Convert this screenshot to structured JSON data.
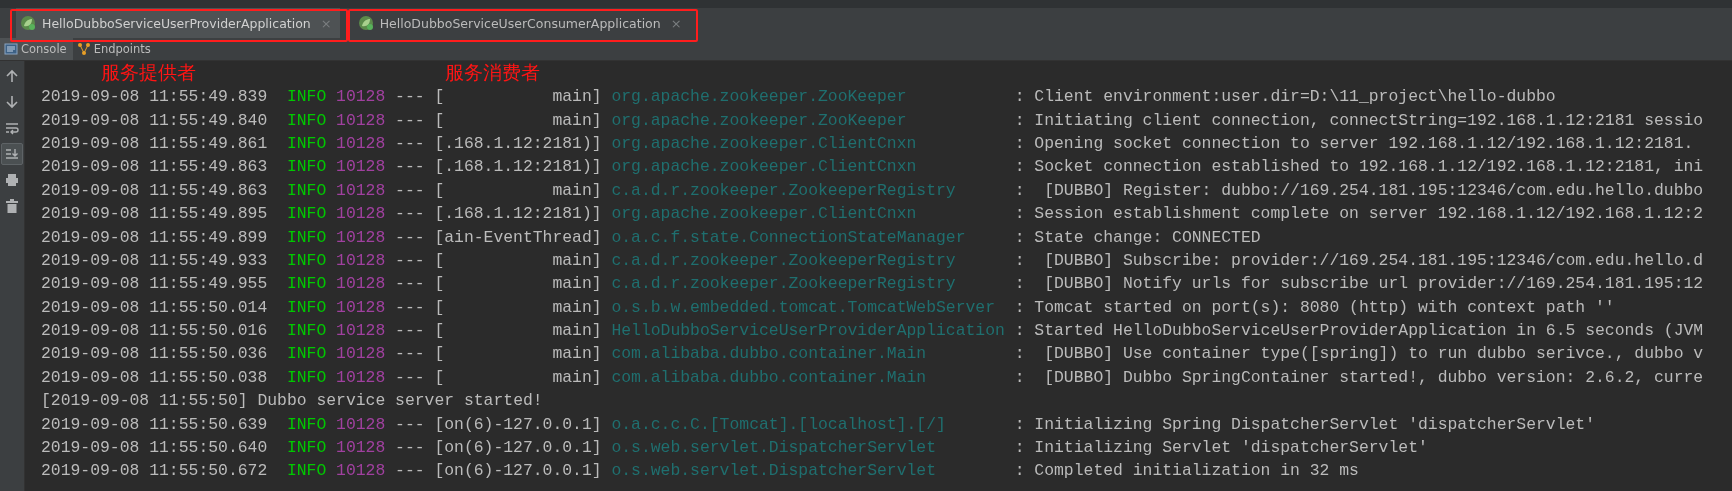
{
  "run_tabs": [
    {
      "label": "HelloDubboServiceUserProviderApplication",
      "close": "×",
      "selected": true,
      "highlighted": true
    },
    {
      "label": "HelloDubboServiceUserConsumerApplication",
      "close": "×",
      "selected": false,
      "highlighted": true
    }
  ],
  "console_tabs": [
    {
      "label": "Console",
      "kind": "console",
      "selected": true
    },
    {
      "label": "Endpoints",
      "kind": "endpoints",
      "selected": false
    }
  ],
  "gutter_tools": [
    {
      "kind": "up",
      "selected": false
    },
    {
      "kind": "down",
      "selected": false
    },
    {
      "kind": "wrap",
      "selected": false
    },
    {
      "kind": "scroll-end",
      "selected": true
    },
    {
      "kind": "print",
      "selected": false
    },
    {
      "kind": "trash",
      "selected": false
    }
  ],
  "log_lines": [
    {
      "kind": "log",
      "time": "2019-09-08 11:55:49.839",
      "level": "INFO",
      "pid": "10128",
      "sep": "---",
      "thread": "[           main]",
      "logger": "org.apache.zookeeper.ZooKeeper",
      "message": ": Client environment:user.dir=D:\\11_project\\hello-dubbo"
    },
    {
      "kind": "log",
      "time": "2019-09-08 11:55:49.840",
      "level": "INFO",
      "pid": "10128",
      "sep": "---",
      "thread": "[           main]",
      "logger": "org.apache.zookeeper.ZooKeeper",
      "message": ": Initiating client connection, connectString=192.168.1.12:2181 sessio"
    },
    {
      "kind": "log",
      "time": "2019-09-08 11:55:49.861",
      "level": "INFO",
      "pid": "10128",
      "sep": "---",
      "thread": "[.168.1.12:2181)]",
      "logger": "org.apache.zookeeper.ClientCnxn",
      "message": ": Opening socket connection to server 192.168.1.12/192.168.1.12:2181."
    },
    {
      "kind": "log",
      "time": "2019-09-08 11:55:49.863",
      "level": "INFO",
      "pid": "10128",
      "sep": "---",
      "thread": "[.168.1.12:2181)]",
      "logger": "org.apache.zookeeper.ClientCnxn",
      "message": ": Socket connection established to 192.168.1.12/192.168.1.12:2181, ini"
    },
    {
      "kind": "log",
      "time": "2019-09-08 11:55:49.863",
      "level": "INFO",
      "pid": "10128",
      "sep": "---",
      "thread": "[           main]",
      "logger": "c.a.d.r.zookeeper.ZookeeperRegistry",
      "message": ":  [DUBBO] Register: dubbo://169.254.181.195:12346/com.edu.hello.dubbo"
    },
    {
      "kind": "log",
      "time": "2019-09-08 11:55:49.895",
      "level": "INFO",
      "pid": "10128",
      "sep": "---",
      "thread": "[.168.1.12:2181)]",
      "logger": "org.apache.zookeeper.ClientCnxn",
      "message": ": Session establishment complete on server 192.168.1.12/192.168.1.12:2"
    },
    {
      "kind": "log",
      "time": "2019-09-08 11:55:49.899",
      "level": "INFO",
      "pid": "10128",
      "sep": "---",
      "thread": "[ain-EventThread]",
      "logger": "o.a.c.f.state.ConnectionStateManager",
      "message": ": State change: CONNECTED"
    },
    {
      "kind": "log",
      "time": "2019-09-08 11:55:49.933",
      "level": "INFO",
      "pid": "10128",
      "sep": "---",
      "thread": "[           main]",
      "logger": "c.a.d.r.zookeeper.ZookeeperRegistry",
      "message": ":  [DUBBO] Subscribe: provider://169.254.181.195:12346/com.edu.hello.d"
    },
    {
      "kind": "log",
      "time": "2019-09-08 11:55:49.955",
      "level": "INFO",
      "pid": "10128",
      "sep": "---",
      "thread": "[           main]",
      "logger": "c.a.d.r.zookeeper.ZookeeperRegistry",
      "message": ":  [DUBBO] Notify urls for subscribe url provider://169.254.181.195:12"
    },
    {
      "kind": "log",
      "time": "2019-09-08 11:55:50.014",
      "level": "INFO",
      "pid": "10128",
      "sep": "---",
      "thread": "[           main]",
      "logger": "o.s.b.w.embedded.tomcat.TomcatWebServer",
      "message": ": Tomcat started on port(s): 8080 (http) with context path ''"
    },
    {
      "kind": "log",
      "time": "2019-09-08 11:55:50.016",
      "level": "INFO",
      "pid": "10128",
      "sep": "---",
      "thread": "[           main]",
      "logger": "HelloDubboServiceUserProviderApplication",
      "message": ": Started HelloDubboServiceUserProviderApplication in 6.5 seconds (JVM"
    },
    {
      "kind": "log",
      "time": "2019-09-08 11:55:50.036",
      "level": "INFO",
      "pid": "10128",
      "sep": "---",
      "thread": "[           main]",
      "logger": "com.alibaba.dubbo.container.Main",
      "message": ":  [DUBBO] Use container type([spring]) to run dubbo serivce., dubbo v"
    },
    {
      "kind": "log",
      "time": "2019-09-08 11:55:50.038",
      "level": "INFO",
      "pid": "10128",
      "sep": "---",
      "thread": "[           main]",
      "logger": "com.alibaba.dubbo.container.Main",
      "message": ":  [DUBBO] Dubbo SpringContainer started!, dubbo version: 2.6.2, curre"
    },
    {
      "kind": "plain",
      "text": "[2019-09-08 11:55:50] Dubbo service server started!"
    },
    {
      "kind": "log",
      "time": "2019-09-08 11:55:50.639",
      "level": "INFO",
      "pid": "10128",
      "sep": "---",
      "thread": "[on(6)-127.0.0.1]",
      "logger": "o.a.c.c.C.[Tomcat].[localhost].[/]",
      "message": ": Initializing Spring DispatcherServlet 'dispatcherServlet'"
    },
    {
      "kind": "log",
      "time": "2019-09-08 11:55:50.640",
      "level": "INFO",
      "pid": "10128",
      "sep": "---",
      "thread": "[on(6)-127.0.0.1]",
      "logger": "o.s.web.servlet.DispatcherServlet",
      "message": ": Initializing Servlet 'dispatcherServlet'"
    },
    {
      "kind": "log",
      "time": "2019-09-08 11:55:50.672",
      "level": "INFO",
      "pid": "10128",
      "sep": "---",
      "thread": "[on(6)-127.0.0.1]",
      "logger": "o.s.web.servlet.DispatcherServlet",
      "message": ": Completed initialization in 32 ms"
    }
  ],
  "annotations": [
    {
      "text": "服务提供者"
    },
    {
      "text": "服务消费者"
    }
  ]
}
